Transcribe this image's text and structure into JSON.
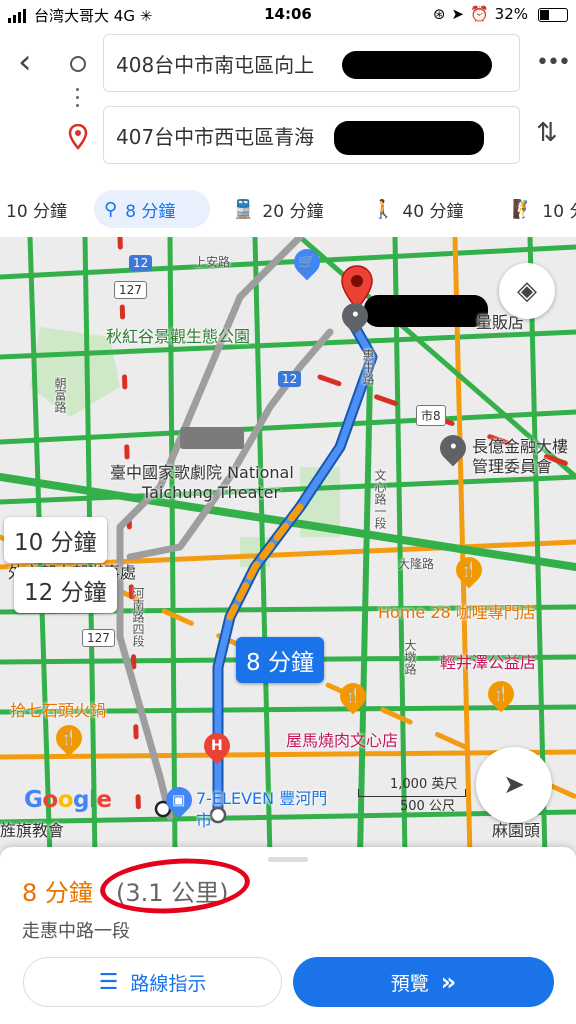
{
  "status_bar": {
    "carrier": "台湾大哥大",
    "network": "4G",
    "time": "14:06",
    "battery": "32%"
  },
  "route": {
    "origin": "408台中市南屯區向上",
    "destination": "407台中市西屯區青海",
    "more_icon": "more-vert-icon",
    "swap_icon": "swap-icon"
  },
  "modes": [
    {
      "icon": "car-icon",
      "label": "10 分鐘"
    },
    {
      "icon": "motorcycle-icon",
      "label": "8 分鐘",
      "selected": true
    },
    {
      "icon": "transit-icon",
      "label": "20 分鐘"
    },
    {
      "icon": "walk-icon",
      "label": "40 分鐘"
    },
    {
      "icon": "hike-icon",
      "label": "10 分"
    }
  ],
  "map": {
    "labels": {
      "park": "秋紅谷景觀生態公園",
      "theater_1": "臺中國家歌劇院 National",
      "theater_2": "Taichung Theater",
      "store": "量販店",
      "finance_1": "長億金融大樓",
      "finance_2": "管理委員會",
      "home28": "Home 28 咖哩專門店",
      "karuizawa": "輕井澤公益店",
      "hotpot": "拾七石頭火鍋",
      "yakiniku": "屋馬燒肉文心店",
      "seven": "7-ELEVEN 豐河門",
      "seven_2": "市",
      "office": "外交部中部辦事處",
      "temple": "旌旗教會",
      "park2": "麻園頭",
      "road_chaofu": "朝富路",
      "road_huizhong": "惠中路",
      "road_wenxin": "文心路一段",
      "road_dadun": "大隆路",
      "road_dadun2": "大墩路",
      "road_henan": "河南路四段",
      "road_shang": "上安路"
    },
    "shields": {
      "r12a": "12",
      "r12b": "12",
      "r127a": "127",
      "r127b": "127",
      "city8": "市8"
    },
    "bubbles": {
      "main": "8 分鐘",
      "alt1": "10 分鐘",
      "alt2": "12 分鐘"
    },
    "scale": {
      "imperial": "1,000 英尺",
      "metric": "500 公尺"
    },
    "logo": "Google",
    "colors": {
      "route": "#1a73e8",
      "traffic_green": "#34b04a",
      "traffic_orange": "#f39c12",
      "traffic_red": "#d93025"
    }
  },
  "sheet": {
    "eta": "8 分鐘",
    "distance": "(3.1 公里)",
    "via": "走惠中路一段",
    "steps_label": "路線指示",
    "preview_label": "預覽"
  }
}
